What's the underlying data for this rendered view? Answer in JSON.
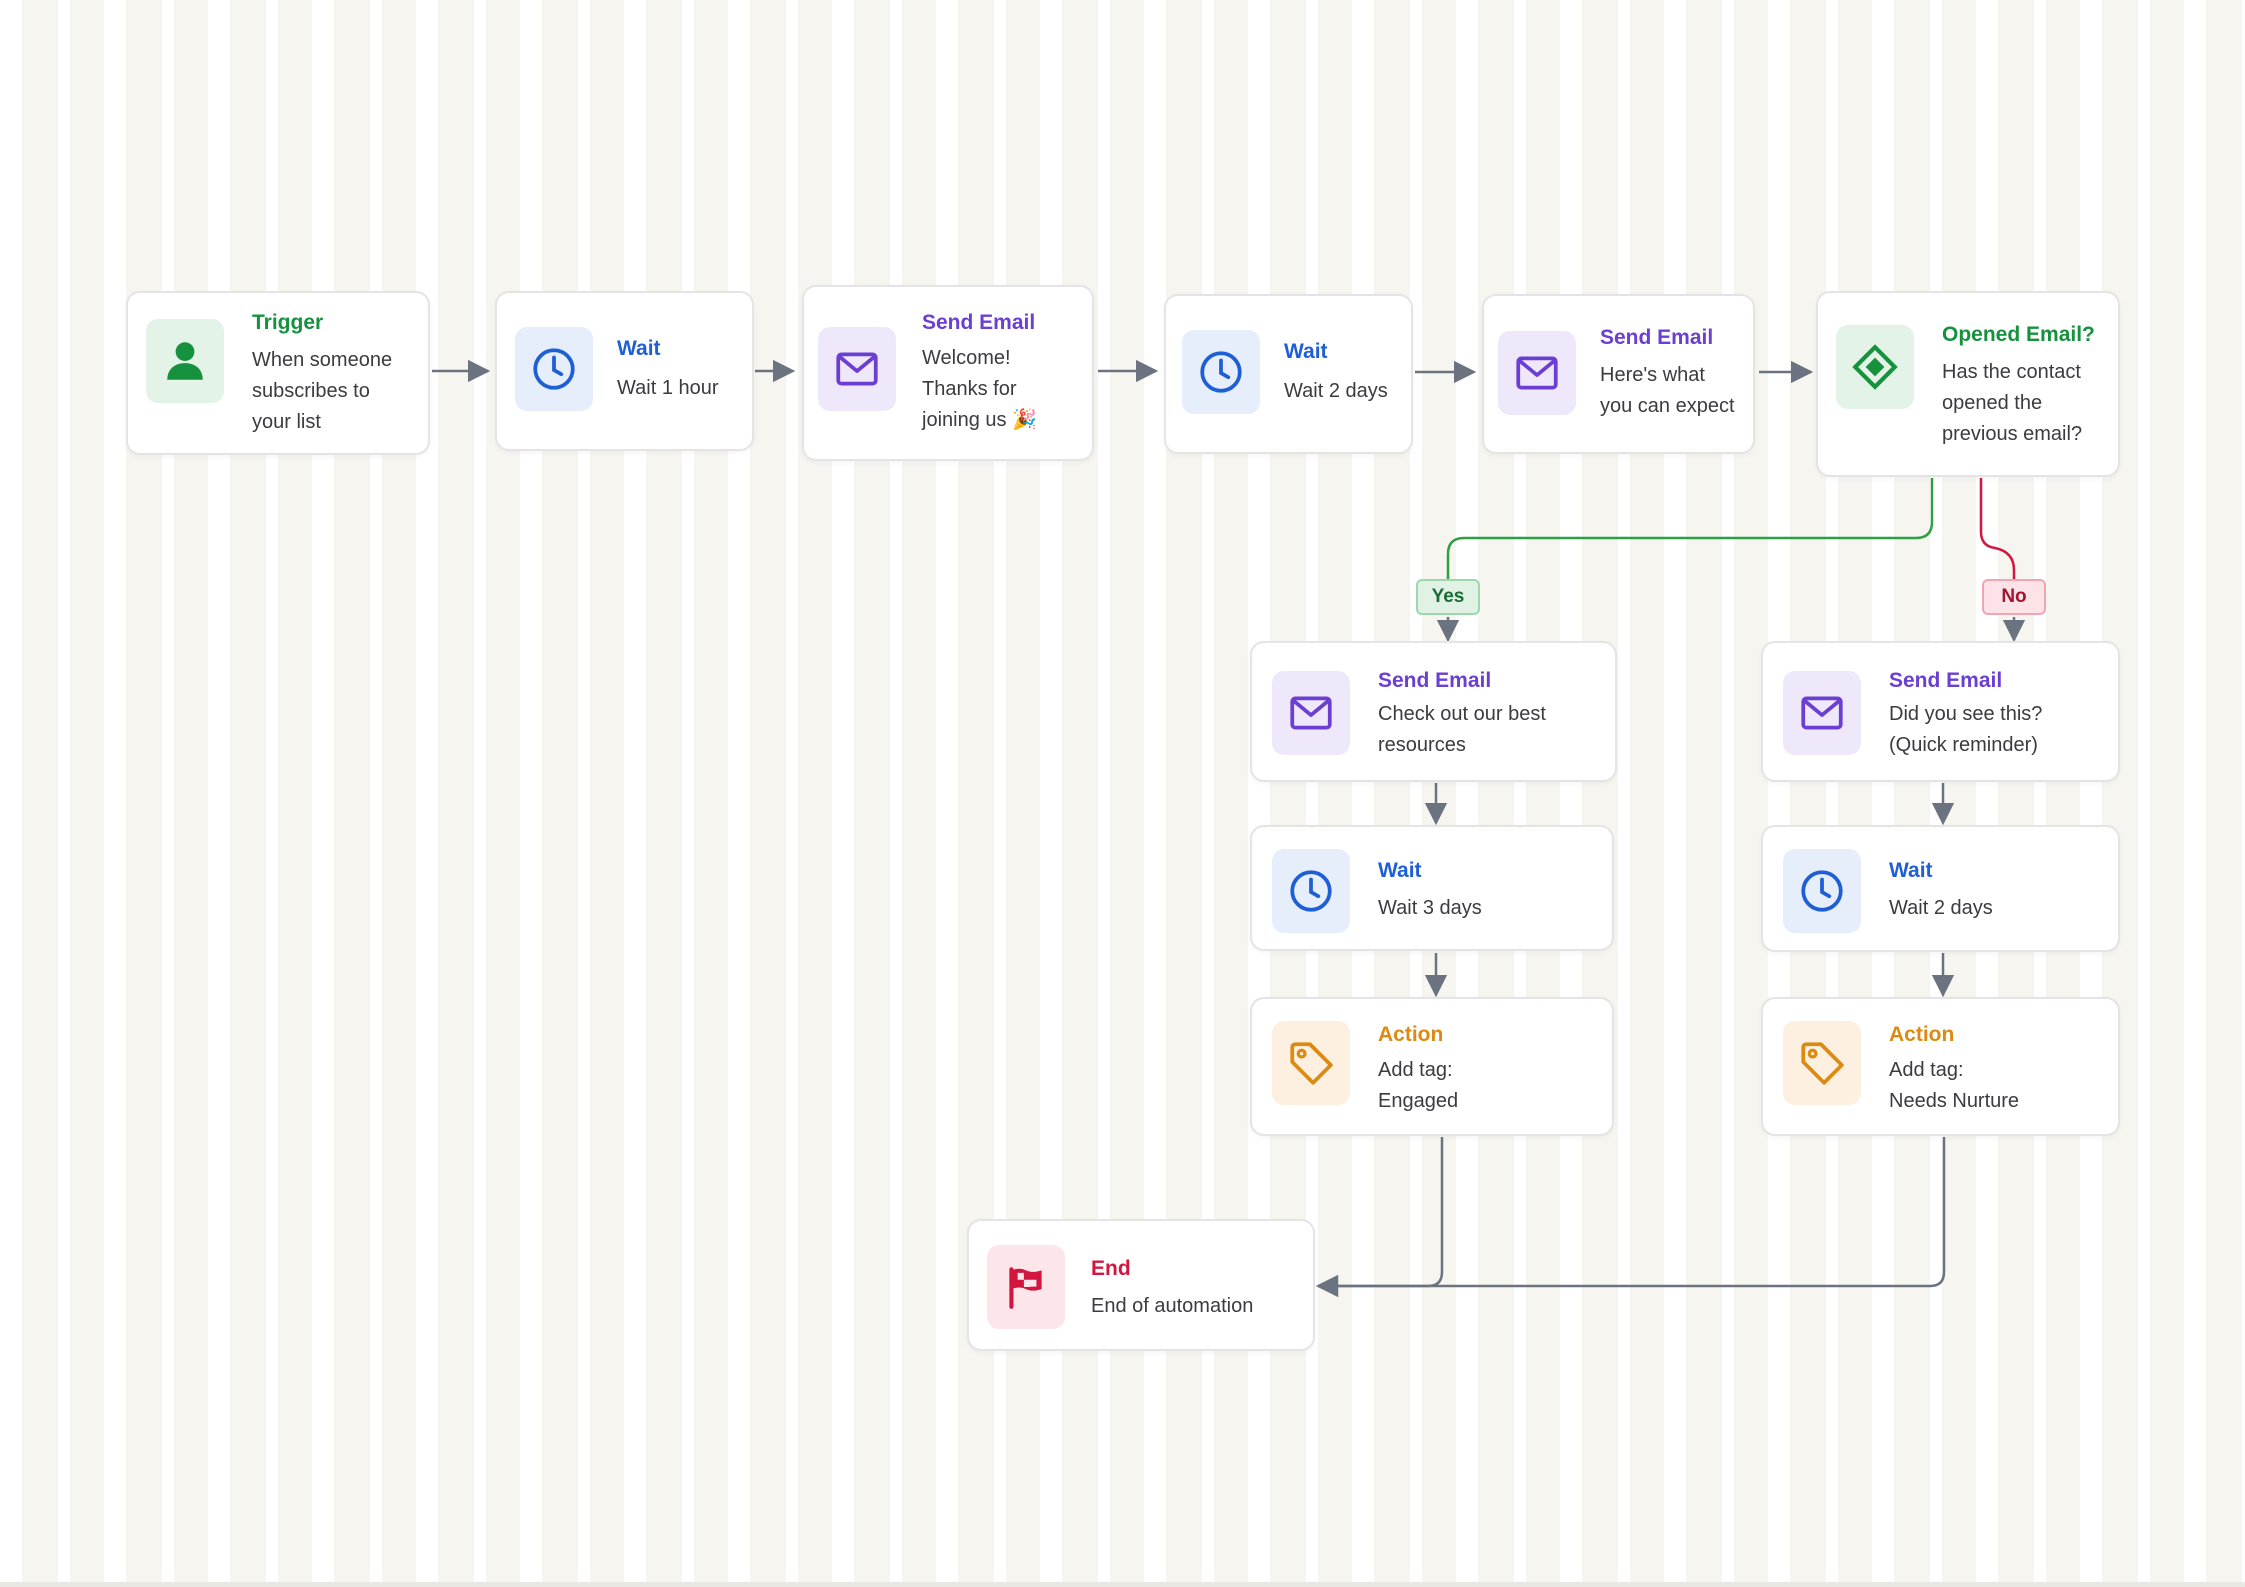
{
  "colors": {
    "trigger": "#16913d",
    "wait": "#1f5fd6",
    "send_email": "#6a3fd1",
    "condition": "#16913d",
    "action": "#db8a12",
    "end": "#d1173f",
    "connector": "#6b7280",
    "yes_branch": "#2ea043",
    "no_branch": "#d1173f"
  },
  "nodes": {
    "trigger": {
      "title": "Trigger",
      "description": "When someone\nsubscribes to\nyour list",
      "icon": "person-icon"
    },
    "wait_1": {
      "title": "Wait",
      "description": "Wait 1 hour",
      "icon": "clock-icon"
    },
    "email_1": {
      "title": "Send Email",
      "description": "Welcome!\nThanks for\njoining us 🎉",
      "icon": "envelope-icon"
    },
    "wait_2": {
      "title": "Wait",
      "description": "Wait 2 days",
      "icon": "clock-icon"
    },
    "email_2": {
      "title": "Send Email",
      "description": "Here's what\nyou can expect",
      "icon": "envelope-icon"
    },
    "condition": {
      "title": "Opened Email?",
      "description": "Has the contact\nopened the\nprevious email?",
      "icon": "diamond-icon"
    },
    "yes_email": {
      "title": "Send Email",
      "description": "Check out our best\nresources",
      "icon": "envelope-icon"
    },
    "yes_wait": {
      "title": "Wait",
      "description": "Wait 3 days",
      "icon": "clock-icon"
    },
    "yes_action": {
      "title": "Action",
      "description": "Add tag:\nEngaged",
      "icon": "tag-icon"
    },
    "no_email": {
      "title": "Send Email",
      "description": "Did you see this?\n(Quick reminder)",
      "icon": "envelope-icon"
    },
    "no_wait": {
      "title": "Wait",
      "description": "Wait 2 days",
      "icon": "clock-icon"
    },
    "no_action": {
      "title": "Action",
      "description": "Add tag:\nNeeds Nurture",
      "icon": "tag-icon"
    },
    "end": {
      "title": "End",
      "description": "End of automation",
      "icon": "flag-icon"
    }
  },
  "branches": {
    "yes": "Yes",
    "no": "No"
  }
}
